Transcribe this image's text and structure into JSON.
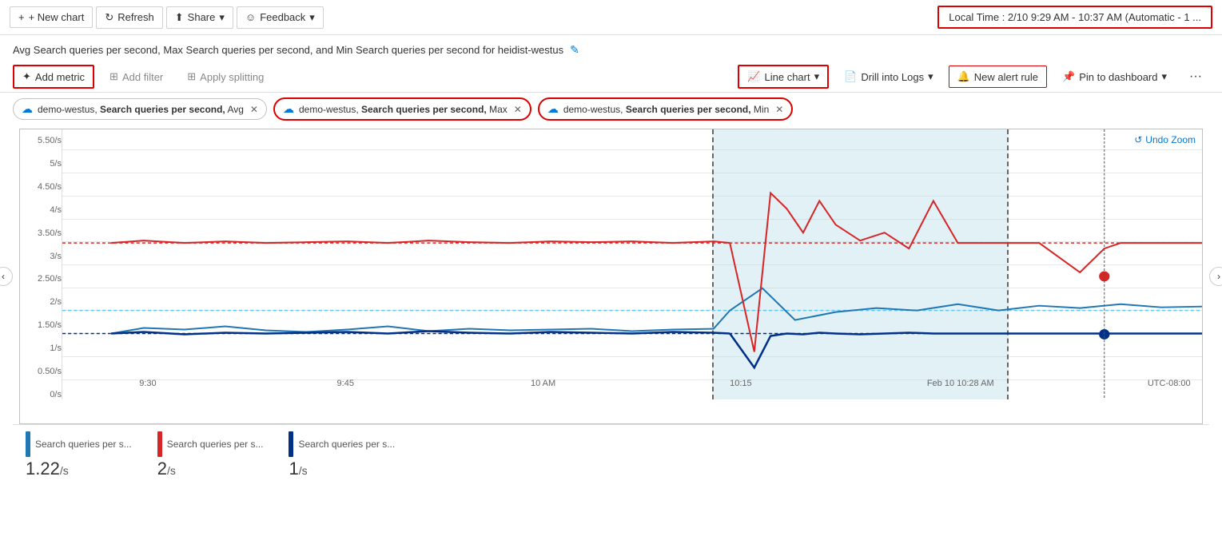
{
  "topToolbar": {
    "newChart": "+ New chart",
    "refresh": "Refresh",
    "share": "Share",
    "shareChevron": "▾",
    "feedback": "Feedback",
    "feedbackChevron": "▾",
    "timeRange": "Local Time : 2/10 9:29 AM - 10:37 AM (Automatic - 1 ..."
  },
  "chartTitle": "Avg Search queries per second, Max Search queries per second, and Min Search queries per second for heidist-westus",
  "metricsToolbar": {
    "addMetric": "Add metric",
    "addFilter": "Add filter",
    "applySplitting": "Apply splitting",
    "lineChart": "Line chart",
    "lineChartChevron": "▾",
    "drillIntoLogs": "Drill into Logs",
    "drillChevron": "▾",
    "newAlertRule": "New alert rule",
    "pinToDashboard": "Pin to dashboard",
    "pinChevron": "▾",
    "more": "···"
  },
  "pills": [
    {
      "id": 1,
      "resource": "demo-westus",
      "metric": "Search queries per second",
      "aggregation": "Avg",
      "outlined": false
    },
    {
      "id": 2,
      "resource": "demo-westus",
      "metric": "Search queries per second",
      "aggregation": "Max",
      "outlined": true
    },
    {
      "id": 3,
      "resource": "demo-westus",
      "metric": "Search queries per second",
      "aggregation": "Min",
      "outlined": true
    }
  ],
  "chart": {
    "undoZoom": "Undo Zoom",
    "yLabels": [
      "5.50/s",
      "5/s",
      "4.50/s",
      "4/s",
      "3.50/s",
      "3/s",
      "2.50/s",
      "2/s",
      "1.50/s",
      "1/s",
      "0.50/s",
      "0/s"
    ],
    "xLabels": [
      {
        "label": "9:30",
        "pct": 4
      },
      {
        "label": "9:45",
        "pct": 22
      },
      {
        "label": "10 AM",
        "pct": 40
      },
      {
        "label": "10:15",
        "pct": 58
      },
      {
        "label": "Feb 10 10:28 AM",
        "pct": 78
      },
      {
        "label": "UTC-08:00",
        "pct": 97
      }
    ],
    "zoomStart": 57,
    "zoomEnd": 83
  },
  "legend": [
    {
      "color": "#1f77b4",
      "label": "Search queries per s...",
      "value": "1.22",
      "unit": "/s"
    },
    {
      "color": "#d62728",
      "label": "Search queries per s...",
      "value": "2",
      "unit": "/s"
    },
    {
      "color": "#003087",
      "label": "Search queries per s...",
      "value": "1",
      "unit": "/s"
    }
  ]
}
